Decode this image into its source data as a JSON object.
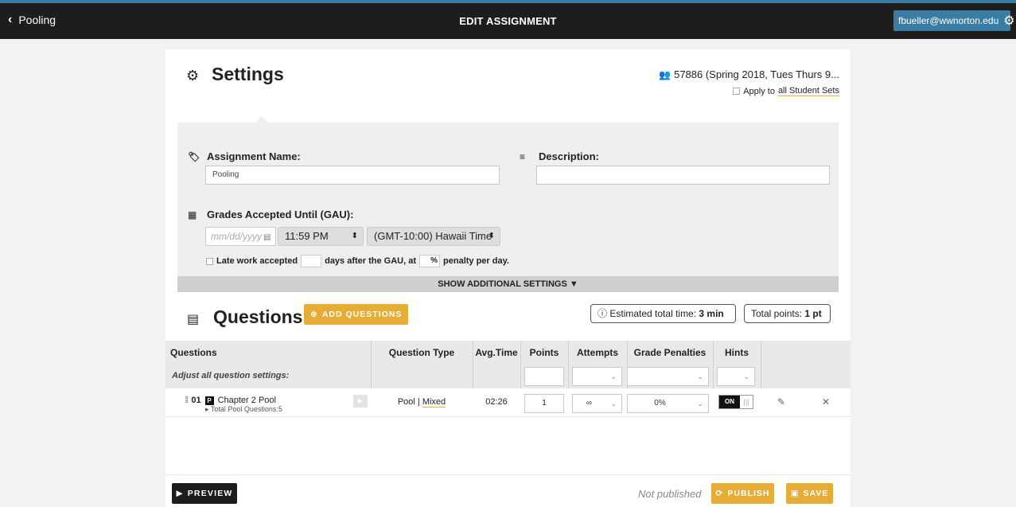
{
  "topbar": {
    "back_label": "Pooling",
    "title": "EDIT ASSIGNMENT",
    "user_email": "fbueller@wwnorton.edu"
  },
  "settings": {
    "heading": "Settings",
    "student_set": "57886 (Spring 2018, Tues Thurs 9...",
    "apply_to_prefix": "Apply to",
    "apply_to_link": "all Student Sets",
    "assignment_name_label": "Assignment Name:",
    "assignment_name_value": "Pooling",
    "description_label": "Description:",
    "description_value": "",
    "gau_label": "Grades Accepted Until (GAU):",
    "date_placeholder": "mm/dd/yyyy",
    "time_value": "11:59 PM",
    "timezone_value": "(GMT-10:00) Hawaii Time",
    "late_work_label": "Late work accepted",
    "late_days_suffix": "days after the GAU, at",
    "late_percent_sign": "%",
    "late_penalty_suffix": "penalty per day.",
    "show_additional": "SHOW ADDITIONAL SETTINGS"
  },
  "questions": {
    "heading": "Questions",
    "add_button": "ADD QUESTIONS",
    "estimated_time_label": "Estimated total time:",
    "estimated_time_value": "3 min",
    "total_points_label": "Total points:",
    "total_points_value": "1 pt",
    "columns": {
      "questions": "Questions",
      "question_type": "Question Type",
      "avg_time": "Avg.Time",
      "points": "Points",
      "attempts": "Attempts",
      "grade_penalties": "Grade Penalties",
      "hints": "Hints"
    },
    "adjust_label": "Adjust all question settings:",
    "rows": [
      {
        "number": "01",
        "badge": "P",
        "title": "Chapter 2 Pool",
        "subtitle": "Total Pool Questions:5",
        "type_prefix": "Pool |",
        "type_link": "Mixed",
        "avg_time": "02:26",
        "points": "1",
        "attempts": "∞",
        "grade_penalty": "0%",
        "hints_state": "ON"
      }
    ]
  },
  "footer": {
    "preview": "PREVIEW",
    "status": "Not published",
    "publish": "PUBLISH",
    "save": "SAVE"
  },
  "colors": {
    "topbar": "#1d1d1d",
    "accent_blue": "#3a7ca5",
    "accent_gold": "#e6ac36"
  }
}
